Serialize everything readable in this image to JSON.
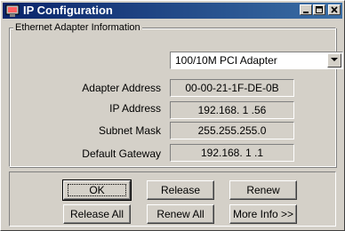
{
  "window": {
    "title": "IP Configuration",
    "icon": "network-config-icon"
  },
  "title_buttons": {
    "minimize_icon": "minimize-icon",
    "maximize_icon": "maximize-icon",
    "close_icon": "close-icon"
  },
  "group": {
    "legend": "Ethernet  Adapter Information"
  },
  "adapter_select": {
    "selected": "100/10M PCI Adapter"
  },
  "fields": {
    "adapter_address": {
      "label": "Adapter Address",
      "value": "00-00-21-1F-DE-0B"
    },
    "ip_address": {
      "label": "IP Address",
      "value": "192.168. 1 .56"
    },
    "subnet_mask": {
      "label": "Subnet Mask",
      "value": "255.255.255.0"
    },
    "default_gateway": {
      "label": "Default Gateway",
      "value": "192.168. 1 .1"
    }
  },
  "buttons": {
    "ok": "OK",
    "release": "Release",
    "renew": "Renew",
    "release_all": "Release All",
    "renew_all": "Renew All",
    "more_info": "More Info >>"
  },
  "colors": {
    "titlebar_start": "#0a246a",
    "titlebar_end": "#3a6ea5",
    "face": "#d4d0c8"
  }
}
